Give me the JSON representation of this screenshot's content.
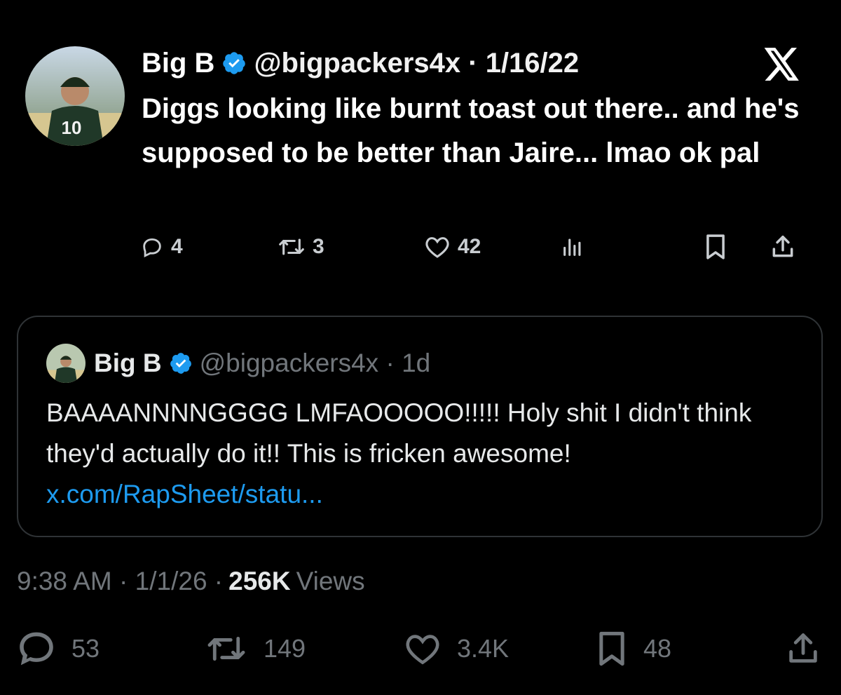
{
  "old_tweet": {
    "display_name": "Big B",
    "handle": "@bigpackers4x",
    "date": "1/16/22",
    "text": "Diggs looking like burnt toast out there.. and he's supposed to be better than Jaire... lmao ok pal",
    "counts": {
      "replies": "4",
      "reposts": "3",
      "likes": "42"
    },
    "avatar_jersey_number": "10"
  },
  "quote": {
    "display_name": "Big B",
    "handle": "@bigpackers4x",
    "age": "1d",
    "text": "BAAAANNNNGGGG LMFAOOOOO!!!!! Holy shit I didn't think they'd actually do it!! This is fricken awesome! ",
    "link_text": "x.com/RapSheet/statu..."
  },
  "meta": {
    "time": "9:38 AM",
    "date": "1/1/26",
    "views_count": "256K",
    "views_label": "Views"
  },
  "actions": {
    "replies": "53",
    "reposts": "149",
    "likes": "3.4K",
    "bookmarks": "48"
  },
  "colors": {
    "background": "#000000",
    "link": "#1d9bf0",
    "verified_badge": "#1d9bf0",
    "muted_text": "#71767b"
  },
  "icons": [
    "verified-badge-icon",
    "x-logo-icon",
    "reply-icon",
    "repost-icon",
    "like-icon",
    "views-icon",
    "bookmark-icon",
    "share-icon"
  ]
}
